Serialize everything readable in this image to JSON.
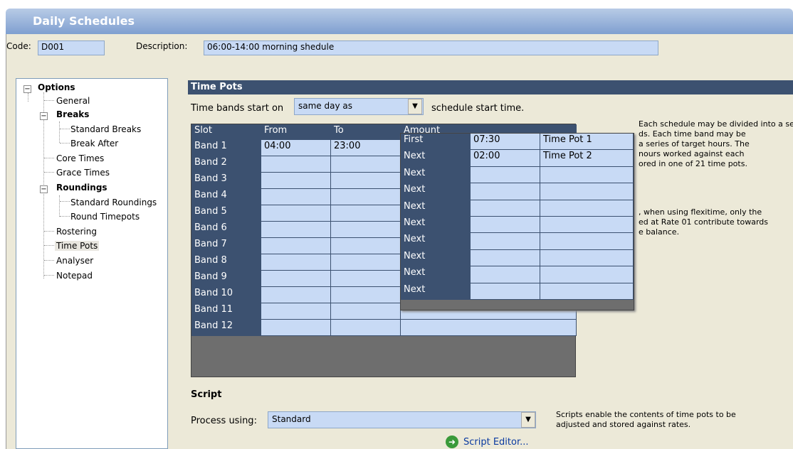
{
  "window": {
    "title": "Daily Schedules"
  },
  "header": {
    "code_label": "Code:",
    "code_value": "D001",
    "description_label": "Description:",
    "description_value": "06:00-14:00 morning shedule"
  },
  "tree": {
    "options": "Options",
    "general": "General",
    "breaks": "Breaks",
    "standard_breaks": "Standard Breaks",
    "break_after": "Break After",
    "core_times": "Core Times",
    "grace_times": "Grace Times",
    "roundings": "Roundings",
    "standard_roundings": "Standard Roundings",
    "round_timepots": "Round Timepots",
    "rostering": "Rostering",
    "time_pots": "Time Pots",
    "analyser": "Analyser",
    "notepad": "Notepad",
    "expanded_sign": "−"
  },
  "timepots": {
    "section_title": "Time Pots",
    "bands_label": "Time bands start on",
    "bands_value": "same day as",
    "bands_suffix": "schedule start time.",
    "columns": [
      "Slot",
      "From",
      "To",
      "Amount"
    ],
    "bands": [
      {
        "slot": "Band 1",
        "from": "04:00",
        "to": "23:00"
      },
      {
        "slot": "Band 2",
        "from": "",
        "to": ""
      },
      {
        "slot": "Band 3",
        "from": "",
        "to": ""
      },
      {
        "slot": "Band 4",
        "from": "",
        "to": ""
      },
      {
        "slot": "Band 5",
        "from": "",
        "to": ""
      },
      {
        "slot": "Band 6",
        "from": "",
        "to": ""
      },
      {
        "slot": "Band 7",
        "from": "",
        "to": ""
      },
      {
        "slot": "Band 8",
        "from": "",
        "to": ""
      },
      {
        "slot": "Band 9",
        "from": "",
        "to": ""
      },
      {
        "slot": "Band 10",
        "from": "",
        "to": ""
      },
      {
        "slot": "Band 11",
        "from": "",
        "to": ""
      },
      {
        "slot": "Band 12",
        "from": "",
        "to": ""
      }
    ],
    "popup_rows": [
      {
        "label": "First",
        "amount": "07:30",
        "pot": "Time Pot 1"
      },
      {
        "label": "Next",
        "amount": "02:00",
        "pot": "Time Pot 2"
      },
      {
        "label": "Next",
        "amount": "",
        "pot": ""
      },
      {
        "label": "Next",
        "amount": "",
        "pot": ""
      },
      {
        "label": "Next",
        "amount": "",
        "pot": ""
      },
      {
        "label": "Next",
        "amount": "",
        "pot": ""
      },
      {
        "label": "Next",
        "amount": "",
        "pot": ""
      },
      {
        "label": "Next",
        "amount": "",
        "pot": ""
      },
      {
        "label": "Next",
        "amount": "",
        "pot": ""
      },
      {
        "label": "Next",
        "amount": "",
        "pot": ""
      }
    ],
    "help_1": [
      "Each schedule may be divided into a series",
      "ds.  Each time band may be",
      "a series of target hours.  The",
      "nours worked against each",
      "ored in one of 21 time pots."
    ],
    "help_2": [
      ", when using flexitime, only the",
      "ed at Rate 01 contribute towards",
      "e balance."
    ]
  },
  "script": {
    "title": "Script",
    "process_label": "Process using:",
    "process_value": "Standard",
    "help": [
      "Scripts enable the contents of time pots to be",
      "adjusted and stored against rates."
    ],
    "editor_link": "Script Editor...",
    "editor_icon": "arrow-circle-icon"
  },
  "dropdown_glyph": "▼"
}
